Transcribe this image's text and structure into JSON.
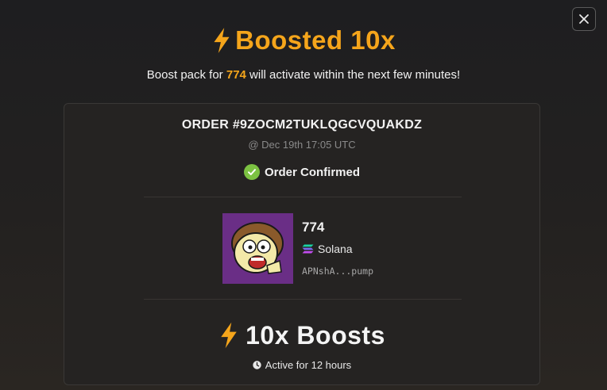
{
  "modal": {
    "close_icon": "close-icon",
    "title": "Boosted 10x",
    "subtitle_prefix": "Boost pack for ",
    "subtitle_token": "774",
    "subtitle_suffix": " will activate within the next few minutes!",
    "accent_color": "#f5a51b"
  },
  "order": {
    "id": "ORDER #9ZOCM2TUKLQGCVQUAKDZ",
    "date": "@ Dec 19th 17:05 UTC",
    "status": "Order Confirmed",
    "status_color": "#7cc242"
  },
  "token": {
    "name": "774",
    "chain": "Solana",
    "address": "APNshA...pump",
    "image_bg": "#6a2e86"
  },
  "boost": {
    "amount": "10x Boosts",
    "duration": "Active for 12 hours"
  }
}
